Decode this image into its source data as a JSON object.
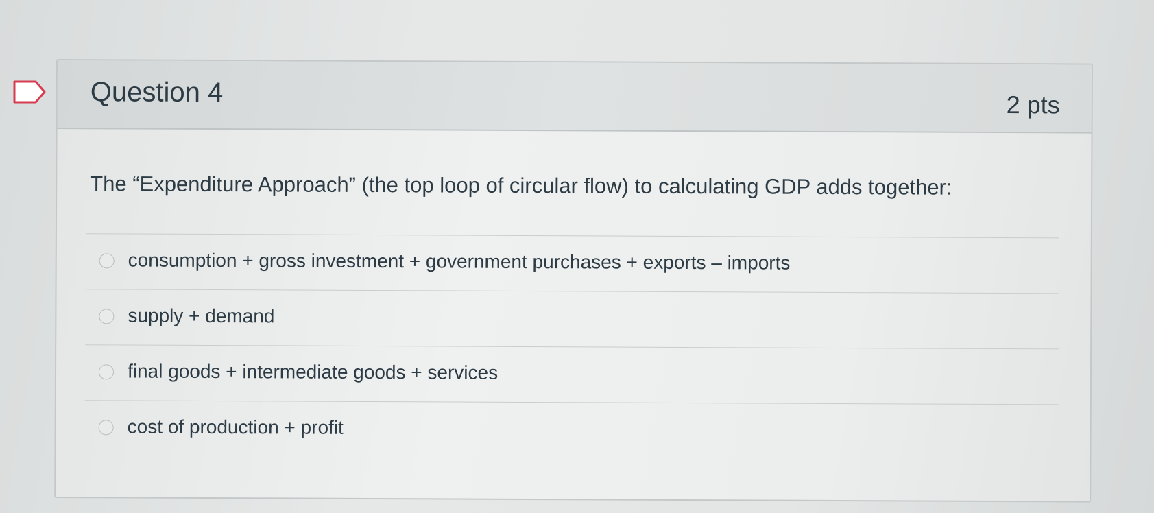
{
  "colors": {
    "text": "#2d3b45",
    "background": "#e6e8e8",
    "header_background": "#dbdede",
    "border": "#c4c8c8"
  },
  "icons": {
    "flag": "flag-question-icon",
    "radio": "radio-button-icon"
  },
  "question": {
    "title": "Question 4",
    "points": "2 pts",
    "text": "The “Expenditure Approach” (the top loop of circular flow) to calculating GDP adds together:"
  },
  "answers": [
    {
      "label": "consumption + gross investment + government purchases + exports – imports",
      "selected": false
    },
    {
      "label": "supply + demand",
      "selected": false
    },
    {
      "label": "final goods + intermediate goods + services",
      "selected": false
    },
    {
      "label": "cost of production + profit",
      "selected": false
    }
  ]
}
